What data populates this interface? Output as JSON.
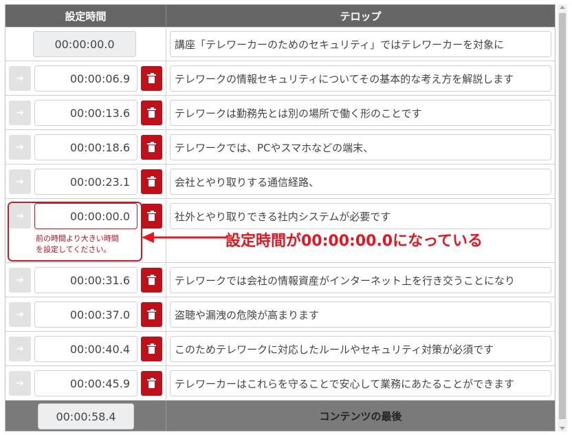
{
  "header": {
    "time_col": "設定時間",
    "caption_col": "テロップ"
  },
  "rows": [
    {
      "time": "00:00:00.0",
      "caption": "講座「テレワーカーのためのセキュリティ」ではテレワーカーを対象に"
    },
    {
      "time": "00:00:06.9",
      "caption": "テレワークの情報セキュリティについてその基本的な考え方を解説します"
    },
    {
      "time": "00:00:13.6",
      "caption": "テレワークは勤務先とは別の場所で働く形のことです"
    },
    {
      "time": "00:00:18.6",
      "caption": "テレワークでは、PCやスマホなどの端末、"
    },
    {
      "time": "00:00:23.1",
      "caption": "会社とやり取りする通信経路、"
    },
    {
      "time": "00:00:00.0",
      "caption": "社外とやり取りできる社内システムが必要です",
      "error": "前の時間より大きい時間\nを設定してください。"
    },
    {
      "time": "00:00:31.6",
      "caption": "テレワークでは会社の情報資産がインターネット上を行き交うことになり"
    },
    {
      "time": "00:00:37.0",
      "caption": "盗聴や漏洩の危険が高まります"
    },
    {
      "time": "00:00:40.4",
      "caption": "このためテレワークに対応したルールやセキュリティ対策が必須です"
    },
    {
      "time": "00:00:45.9",
      "caption": "テレワーカーはこれらを守ることで安心して業務にあたることができます"
    }
  ],
  "footer": {
    "time": "00:00:58.4",
    "label": "コンテンツの最後"
  },
  "annotation": {
    "text": "設定時間が00:00:00.0になっている"
  },
  "icons": {
    "arrow": "arrow-right-icon",
    "delete": "trash-icon"
  },
  "colors": {
    "header_bg": "#666666",
    "delete_bg": "#c0101a",
    "error": "#d9151e",
    "footer_bg": "#7a7a7a"
  }
}
